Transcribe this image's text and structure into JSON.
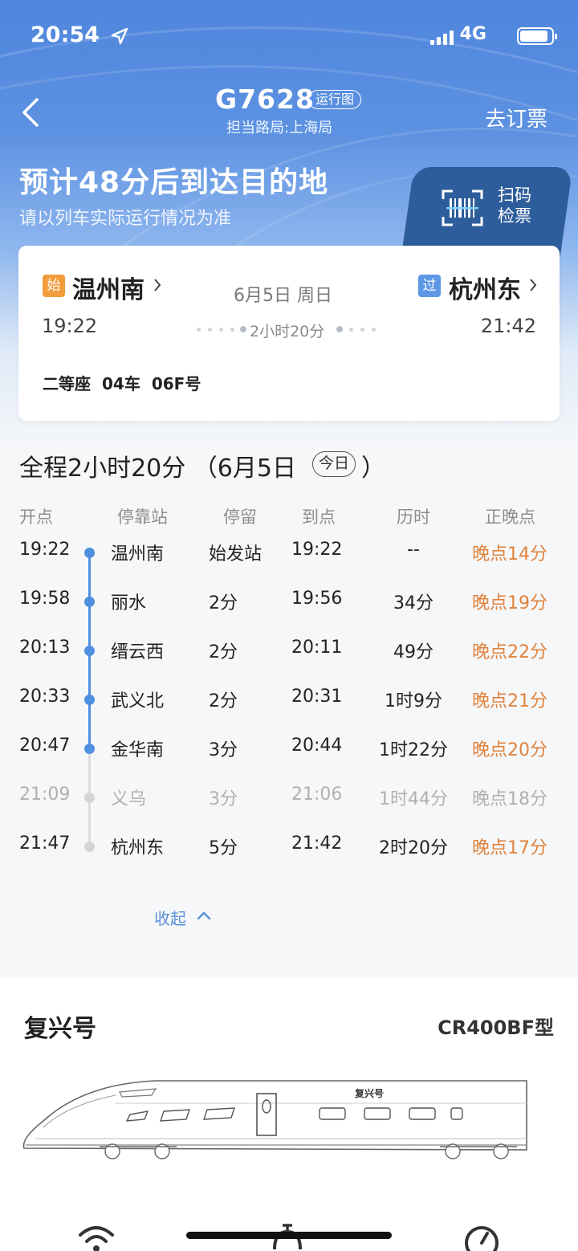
{
  "status_bar": {
    "time": "20:54",
    "network": "4G"
  },
  "header": {
    "train_number": "G7628",
    "run_chart_label": "运行图",
    "bureau": "担当路局:上海局",
    "book_label": "去订票"
  },
  "eta": {
    "headline": "预计48分后到达目的地",
    "note": "请以列车实际运行情况为准"
  },
  "scan": {
    "line1": "扫码",
    "line2": "检票"
  },
  "ticket": {
    "from_badge": "始",
    "from_station": "温州南",
    "to_badge": "过",
    "to_station": "杭州东",
    "date": "6月5日 周日",
    "dep_time": "19:22",
    "arr_time": "21:42",
    "duration": "2小时20分",
    "seat_class": "二等座",
    "car": "04车",
    "seat": "06F号"
  },
  "schedule": {
    "title": "全程2小时20分 （6月5日",
    "today": "今日",
    "title_end": "）",
    "headers": [
      "开点",
      "停靠站",
      "停留",
      "到点",
      "历时",
      "正晚点"
    ],
    "rows": [
      {
        "dep": "19:22",
        "station": "温州南",
        "stay": "始发站",
        "arr": "19:22",
        "elapsed": "--",
        "delay": "晚点14分"
      },
      {
        "dep": "19:58",
        "station": "丽水",
        "stay": "2分",
        "arr": "19:56",
        "elapsed": "34分",
        "delay": "晚点19分"
      },
      {
        "dep": "20:13",
        "station": "缙云西",
        "stay": "2分",
        "arr": "20:11",
        "elapsed": "49分",
        "delay": "晚点22分"
      },
      {
        "dep": "20:33",
        "station": "武义北",
        "stay": "2分",
        "arr": "20:31",
        "elapsed": "1时9分",
        "delay": "晚点21分"
      },
      {
        "dep": "20:47",
        "station": "金华南",
        "stay": "3分",
        "arr": "20:44",
        "elapsed": "1时22分",
        "delay": "晚点20分"
      },
      {
        "dep": "21:09",
        "station": "义乌",
        "stay": "3分",
        "arr": "21:06",
        "elapsed": "1时44分",
        "delay": "晚点18分"
      },
      {
        "dep": "21:47",
        "station": "杭州东",
        "stay": "5分",
        "arr": "21:42",
        "elapsed": "2时20分",
        "delay": "晚点17分"
      }
    ],
    "collapse_label": "收起"
  },
  "train_info": {
    "name": "复兴号",
    "model": "CR400BF型",
    "art_label": "复兴号"
  },
  "colors": {
    "accent_blue": "#4f8fe0",
    "delay_orange": "#e0823b",
    "start_badge": "#f29c3b",
    "pass_badge": "#5d97e6"
  }
}
